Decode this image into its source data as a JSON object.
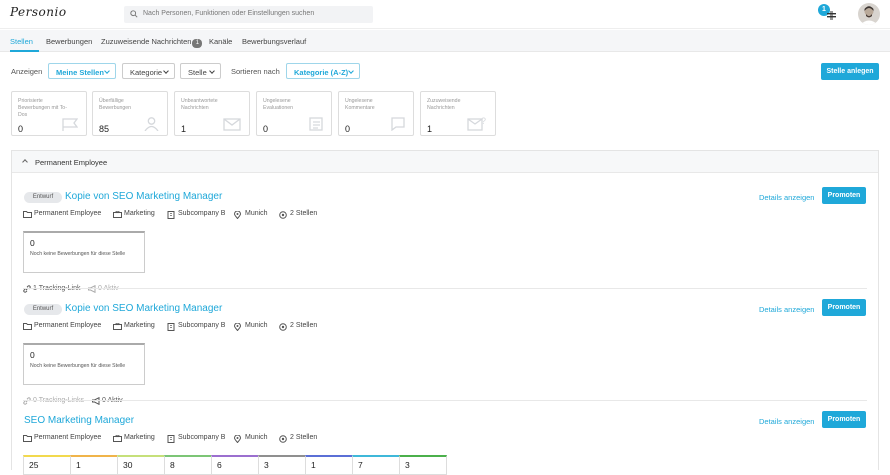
{
  "brand": {
    "logo_text": "Personio"
  },
  "search": {
    "placeholder": "Nach Personen, Funktionen oder Einstellungen suchen"
  },
  "notifications": {
    "count": "1"
  },
  "tabs": [
    {
      "label": "Stellen",
      "active": true
    },
    {
      "label": "Bewerbungen"
    },
    {
      "label": "Zuzuweisende Nachrichten",
      "badge": "1"
    },
    {
      "label": "Kanäle"
    },
    {
      "label": "Bewerbungsverlauf"
    }
  ],
  "filters": {
    "show_label": "Anzeigen",
    "my_jobs": "Meine Stellen",
    "category": "Kategorie",
    "position": "Stelle",
    "sort_label": "Sortieren nach",
    "sort_value": "Kategorie (A-Z)",
    "create_button": "Stelle anlegen"
  },
  "stats": [
    {
      "label": "Priorisierte Bewerbungen mit To-Dos",
      "value": "0",
      "icon": "flag-icon"
    },
    {
      "label": "Überfällige Bewerbungen",
      "value": "85",
      "icon": "person-icon"
    },
    {
      "label": "Unbeantwortete Nachrichten",
      "value": "1",
      "icon": "envelope-icon"
    },
    {
      "label": "Ungelesene Evaluationen",
      "value": "0",
      "icon": "checklist-icon"
    },
    {
      "label": "Ungelesene Kommentare",
      "value": "0",
      "icon": "comment-icon"
    },
    {
      "label": "Zuzuweisende Nachrichten",
      "value": "1",
      "icon": "envelope-question-icon"
    }
  ],
  "group": {
    "title": "Permanent Employee"
  },
  "jobs": [
    {
      "draft": "Entwurf",
      "title": "Kopie von SEO Marketing Manager",
      "employment": "Permanent Employee",
      "department": "Marketing",
      "company": "Subcompany B",
      "office": "Munich",
      "positions": "2 Stellen",
      "applications_count": "0",
      "applications_text": "Noch keine Bewerbungen für diese Stelle",
      "tracking": "1 Tracking-Link",
      "active": "0 Aktiv",
      "details": "Details anzeigen",
      "promote": "Promoten"
    },
    {
      "draft": "Entwurf",
      "title": "Kopie von SEO Marketing Manager",
      "employment": "Permanent Employee",
      "department": "Marketing",
      "company": "Subcompany B",
      "office": "Munich",
      "positions": "2 Stellen",
      "applications_count": "0",
      "applications_text": "Noch keine Bewerbungen für diese Stelle",
      "tracking": "0 Tracking-Links",
      "active": "0 Aktiv",
      "details": "Details anzeigen",
      "promote": "Promoten"
    },
    {
      "title": "SEO Marketing Manager",
      "employment": "Permanent Employee",
      "department": "Marketing",
      "company": "Subcompany B",
      "office": "Munich",
      "positions": "2 Stellen",
      "details": "Details anzeigen",
      "promote": "Promoten",
      "stages": [
        {
          "value": "25",
          "color": "#f2d94e"
        },
        {
          "value": "1",
          "color": "#f0b44a"
        },
        {
          "value": "30",
          "color": "#c6e07a"
        },
        {
          "value": "8",
          "color": "#7cc576"
        },
        {
          "value": "6",
          "color": "#9b6fcf"
        },
        {
          "value": "3",
          "color": "#8f8f8f"
        },
        {
          "value": "1",
          "color": "#5b6fd6"
        },
        {
          "value": "7",
          "color": "#3fb8d9"
        },
        {
          "value": "3",
          "color": "#4bb04b"
        }
      ]
    }
  ],
  "colors": {
    "accent": "#1fa8d9"
  }
}
